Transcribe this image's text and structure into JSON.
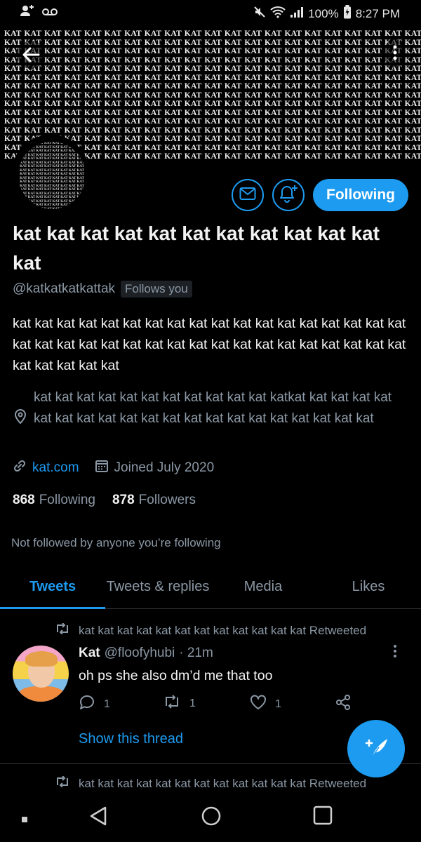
{
  "status_bar": {
    "battery": "100%",
    "time": "8:27 PM"
  },
  "banner": {
    "pattern_word": "KAT"
  },
  "avatar": {
    "pattern_word": "KAT"
  },
  "profile": {
    "display_name": "kat kat kat kat kat kat kat kat kat kat kat kat",
    "handle": "@katkatkatkattak",
    "follows_you": "Follows you",
    "bio": "kat kat kat kat kat kat kat kat kat kat kat kat kat kat kat kat kat kat kat kat kat kat kat kat kat kat kat kat kat kat kat kat kat kat kat kat kat kat kat kat kat",
    "location": "kat kat kat kat kat kat kat kat kat kat kat katkat kat kat kat kat kat kat kat kat kat kat kat kat kat kat kat kat kat kat kat kat",
    "website": "kat.com",
    "joined": "Joined July 2020",
    "following_count": "868",
    "following_label": "Following",
    "followers_count": "878",
    "followers_label": "Followers",
    "not_followed": "Not followed by anyone you’re following"
  },
  "buttons": {
    "following": "Following"
  },
  "tabs": [
    {
      "label": "Tweets",
      "active": true
    },
    {
      "label": "Tweets & replies",
      "active": false
    },
    {
      "label": "Media",
      "active": false
    },
    {
      "label": "Likes",
      "active": false
    }
  ],
  "tweets": [
    {
      "retweeted_by": "kat kat kat kat kat kat kat kat kat kat kat kat Retweeted",
      "name": "Kat",
      "handle": "@floofyhubi",
      "time": "· 21m",
      "text": "oh ps she also dm’d me that too",
      "replies": "1",
      "retweets": "1",
      "likes": "1",
      "show_thread": "Show this thread"
    },
    {
      "retweeted_by": "kat kat kat kat kat kat kat kat kat kat kat kat Retweeted"
    }
  ],
  "colors": {
    "accent": "#1d9bf0",
    "background": "#000000",
    "secondary_text": "#8b98a5"
  },
  "icons": [
    "back-arrow-icon",
    "more-vertical-icon",
    "mail-icon",
    "bell-plus-icon",
    "location-pin-icon",
    "link-icon",
    "calendar-icon",
    "retweet-icon",
    "reply-icon",
    "like-icon",
    "share-icon",
    "compose-icon"
  ]
}
